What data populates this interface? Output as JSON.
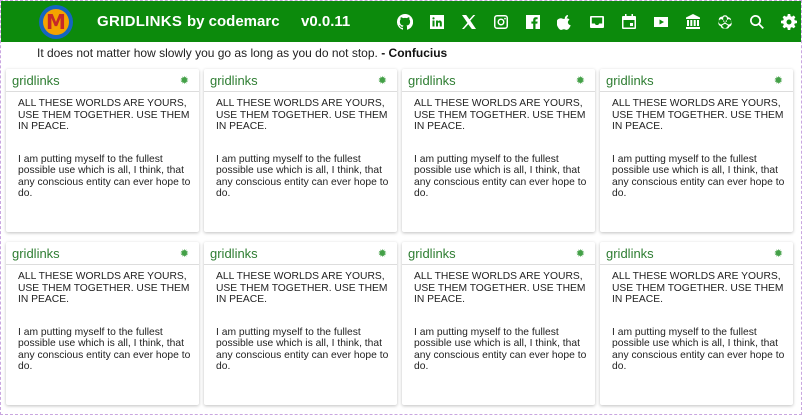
{
  "header": {
    "logo_letter": "M",
    "brand": "GRIDLINKS",
    "author": "by codemarc",
    "version": "v0.0.11",
    "icons": [
      "github-icon",
      "linkedin-icon",
      "x-icon",
      "instagram-icon",
      "facebook-icon",
      "apple-icon",
      "inbox-icon",
      "calendar-icon",
      "youtube-icon",
      "bank-icon",
      "openai-icon",
      "search-icon",
      "gear-icon"
    ],
    "bg_color": "#0c8a0c"
  },
  "quote": {
    "text": "It does not matter how slowly you go as long as you do not stop.",
    "author": "- Confucius"
  },
  "cards": [
    {
      "title": "gridlinks",
      "line1": "ALL THESE WORLDS ARE YOURS, USE THEM TOGETHER. USE THEM IN PEACE.",
      "line2": "I am putting myself to the fullest possible use which is all, I think, that any conscious entity can ever hope to do."
    },
    {
      "title": "gridlinks",
      "line1": "ALL THESE WORLDS ARE YOURS, USE THEM TOGETHER. USE THEM IN PEACE.",
      "line2": "I am putting myself to the fullest possible use which is all, I think, that any conscious entity can ever hope to do."
    },
    {
      "title": "gridlinks",
      "line1": "ALL THESE WORLDS ARE YOURS, USE THEM TOGETHER. USE THEM IN PEACE.",
      "line2": "I am putting myself to the fullest possible use which is all, I think, that any conscious entity can ever hope to do."
    },
    {
      "title": "gridlinks",
      "line1": "ALL THESE WORLDS ARE YOURS, USE THEM TOGETHER. USE THEM IN PEACE.",
      "line2": "I am putting myself to the fullest possible use which is all, I think, that any conscious entity can ever hope to do."
    },
    {
      "title": "gridlinks",
      "line1": "ALL THESE WORLDS ARE YOURS, USE THEM TOGETHER. USE THEM IN PEACE.",
      "line2": "I am putting myself to the fullest possible use which is all, I think, that any conscious entity can ever hope to do."
    },
    {
      "title": "gridlinks",
      "line1": "ALL THESE WORLDS ARE YOURS, USE THEM TOGETHER. USE THEM IN PEACE.",
      "line2": "I am putting myself to the fullest possible use which is all, I think, that any conscious entity can ever hope to do."
    },
    {
      "title": "gridlinks",
      "line1": "ALL THESE WORLDS ARE YOURS, USE THEM TOGETHER. USE THEM IN PEACE.",
      "line2": "I am putting myself to the fullest possible use which is all, I think, that any conscious entity can ever hope to do."
    },
    {
      "title": "gridlinks",
      "line1": "ALL THESE WORLDS ARE YOURS, USE THEM TOGETHER. USE THEM IN PEACE.",
      "line2": "I am putting myself to the fullest possible use which is all, I think, that any conscious entity can ever hope to do."
    }
  ]
}
